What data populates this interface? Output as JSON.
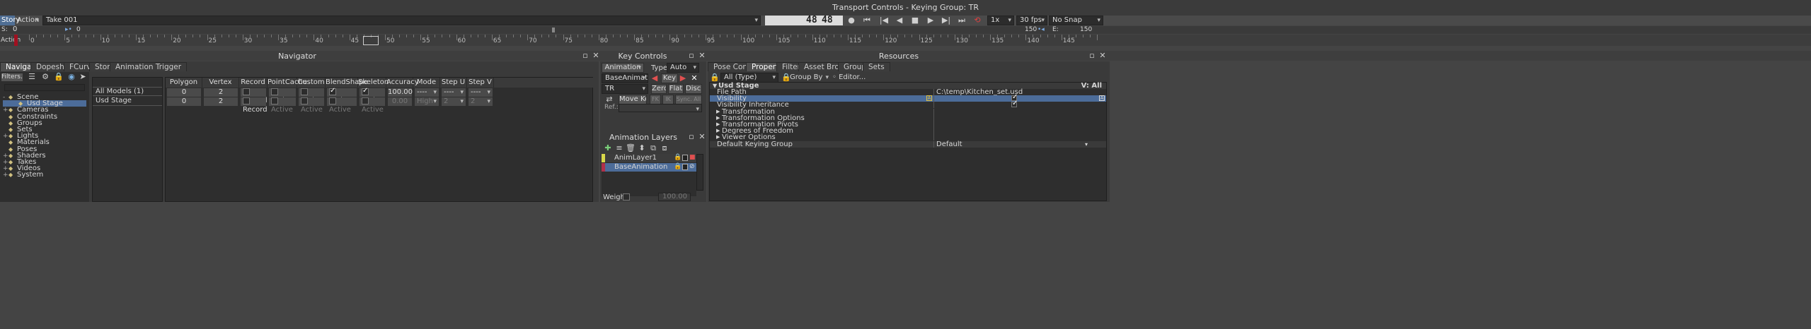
{
  "window_title": "Transport Controls  -  Keying Group: TR",
  "transport": {
    "mode_left": "Story",
    "mode_right": "Action",
    "take": "Take 001",
    "frame_a": "48",
    "frame_b": "48",
    "speed": "1x",
    "fps": "30 fps",
    "snap": "No Snap",
    "start_label": "S:",
    "start_value": "0",
    "mid_value": "0",
    "end_value": "150",
    "end_label": "E:",
    "end_value2": "150",
    "action_label": "Action"
  },
  "timeline": {
    "ticks": [
      "0",
      "5",
      "10",
      "15",
      "20",
      "25",
      "30",
      "35",
      "40",
      "45",
      "50",
      "55",
      "60",
      "65",
      "70",
      "75",
      "80",
      "85",
      "90",
      "95",
      "100",
      "105",
      "110",
      "115",
      "120",
      "125",
      "130",
      "135",
      "140",
      "145"
    ],
    "current_frame": 48,
    "start": 0,
    "end": 150
  },
  "navigator": {
    "title": "Navigator",
    "tabs": [
      "Navigator",
      "Dopesheet",
      "FCurves",
      "Story",
      "Animation Trigger"
    ],
    "filter_label": "Filters...",
    "tree": [
      {
        "label": "Scene",
        "depth": 0,
        "icon": "scene-icon",
        "expand": "-"
      },
      {
        "label": "Usd Stage",
        "depth": 1,
        "icon": "usd-icon",
        "expand": "",
        "selected": true
      },
      {
        "label": "Cameras",
        "depth": 0,
        "icon": "camera-icon",
        "expand": "+"
      },
      {
        "label": "Constraints",
        "depth": 0,
        "icon": "constraint-icon",
        "expand": ""
      },
      {
        "label": "Groups",
        "depth": 0,
        "icon": "group-icon",
        "expand": ""
      },
      {
        "label": "Sets",
        "depth": 0,
        "icon": "sets-icon",
        "expand": ""
      },
      {
        "label": "Lights",
        "depth": 0,
        "icon": "light-icon",
        "expand": "+"
      },
      {
        "label": "Materials",
        "depth": 0,
        "icon": "material-icon",
        "expand": ""
      },
      {
        "label": "Poses",
        "depth": 0,
        "icon": "pose-icon",
        "expand": ""
      },
      {
        "label": "Shaders",
        "depth": 0,
        "icon": "shader-icon",
        "expand": "+"
      },
      {
        "label": "Takes",
        "depth": 0,
        "icon": "take-icon",
        "expand": "+"
      },
      {
        "label": "Videos",
        "depth": 0,
        "icon": "video-icon",
        "expand": "+"
      },
      {
        "label": "System",
        "depth": 0,
        "icon": "system-icon",
        "expand": "+"
      }
    ],
    "models": [
      "All Models (1)",
      "Usd Stage"
    ],
    "columns": [
      "Polygon count",
      "Vertex count",
      "Record",
      "PointCache",
      "Custom",
      "BlendShape",
      "Skeleton",
      "Accuracy",
      "Mode",
      "Step U",
      "Step V"
    ],
    "rows": [
      {
        "poly": "0",
        "vert": "2",
        "record": "Record",
        "pc": "Active",
        "custom": "Active",
        "bs": "Active",
        "skel": "Active",
        "acc": "100.00",
        "mode": "----",
        "su": "----",
        "sv": "----"
      },
      {
        "poly": "0",
        "vert": "2",
        "record": "Record",
        "pc": "Active",
        "custom": "Active",
        "bs": "Active",
        "skel": "Active",
        "acc": "0.00",
        "mode": "High",
        "su": "2",
        "sv": "2"
      }
    ]
  },
  "key_controls": {
    "title": "Key Controls",
    "animation_btn": "Animation",
    "type_label": "Type :",
    "type_value": "Auto",
    "layer_value": "BaseAnimation",
    "key_btn": "Key",
    "group_value": "TR",
    "zero_btn": "Zero",
    "flat_btn": "Flat",
    "disc_btn": "Disc.",
    "move_keys_btn": "Move Keys",
    "fk_btn": "FK",
    "ik_btn": "IK",
    "sync_btn": "Sync. All",
    "ref_label": "Ref.:",
    "layers_title": "Animation Layers",
    "layers": [
      {
        "name": "AnimLayer1",
        "color": "#d8d84a",
        "selected": false
      },
      {
        "name": "BaseAnimation",
        "color": "#b0304a",
        "selected": true
      }
    ],
    "weight_label": "Weight",
    "weight_value": "100.00"
  },
  "resources": {
    "title": "Resources",
    "tabs": [
      "Pose Controls",
      "Properties",
      "Filters",
      "Asset Browser",
      "Groups",
      "Sets"
    ],
    "filter_value": "All (Type)",
    "group_by": "Group By Type",
    "editor_label": "Editor...",
    "header_left": "Usd Stage",
    "header_right": "V: All",
    "props": [
      {
        "name": "File Path",
        "value": "C:\\temp\\Kitchen_set.usd",
        "kind": "text",
        "indent": 1
      },
      {
        "name": "Visibility",
        "value": "",
        "kind": "check",
        "indent": 1,
        "selected": true
      },
      {
        "name": "Visibility Inheritance",
        "value": "",
        "kind": "check",
        "indent": 1
      },
      {
        "name": "Transformation",
        "value": "",
        "kind": "group",
        "indent": 1
      },
      {
        "name": "Transformation Options",
        "value": "",
        "kind": "group",
        "indent": 1
      },
      {
        "name": "Transformation Pivots",
        "value": "",
        "kind": "group",
        "indent": 1
      },
      {
        "name": "Degrees of Freedom",
        "value": "",
        "kind": "group",
        "indent": 1
      },
      {
        "name": "Viewer Options",
        "value": "",
        "kind": "group",
        "indent": 1
      },
      {
        "name": "Default Keying Group",
        "value": "Default",
        "kind": "dropdown",
        "indent": 0
      }
    ]
  },
  "colors": {
    "accent": "#4f6e94",
    "selection": "#4c6c99",
    "panel": "#3a3a3a",
    "timeline_marker": "#d0d0d0"
  }
}
